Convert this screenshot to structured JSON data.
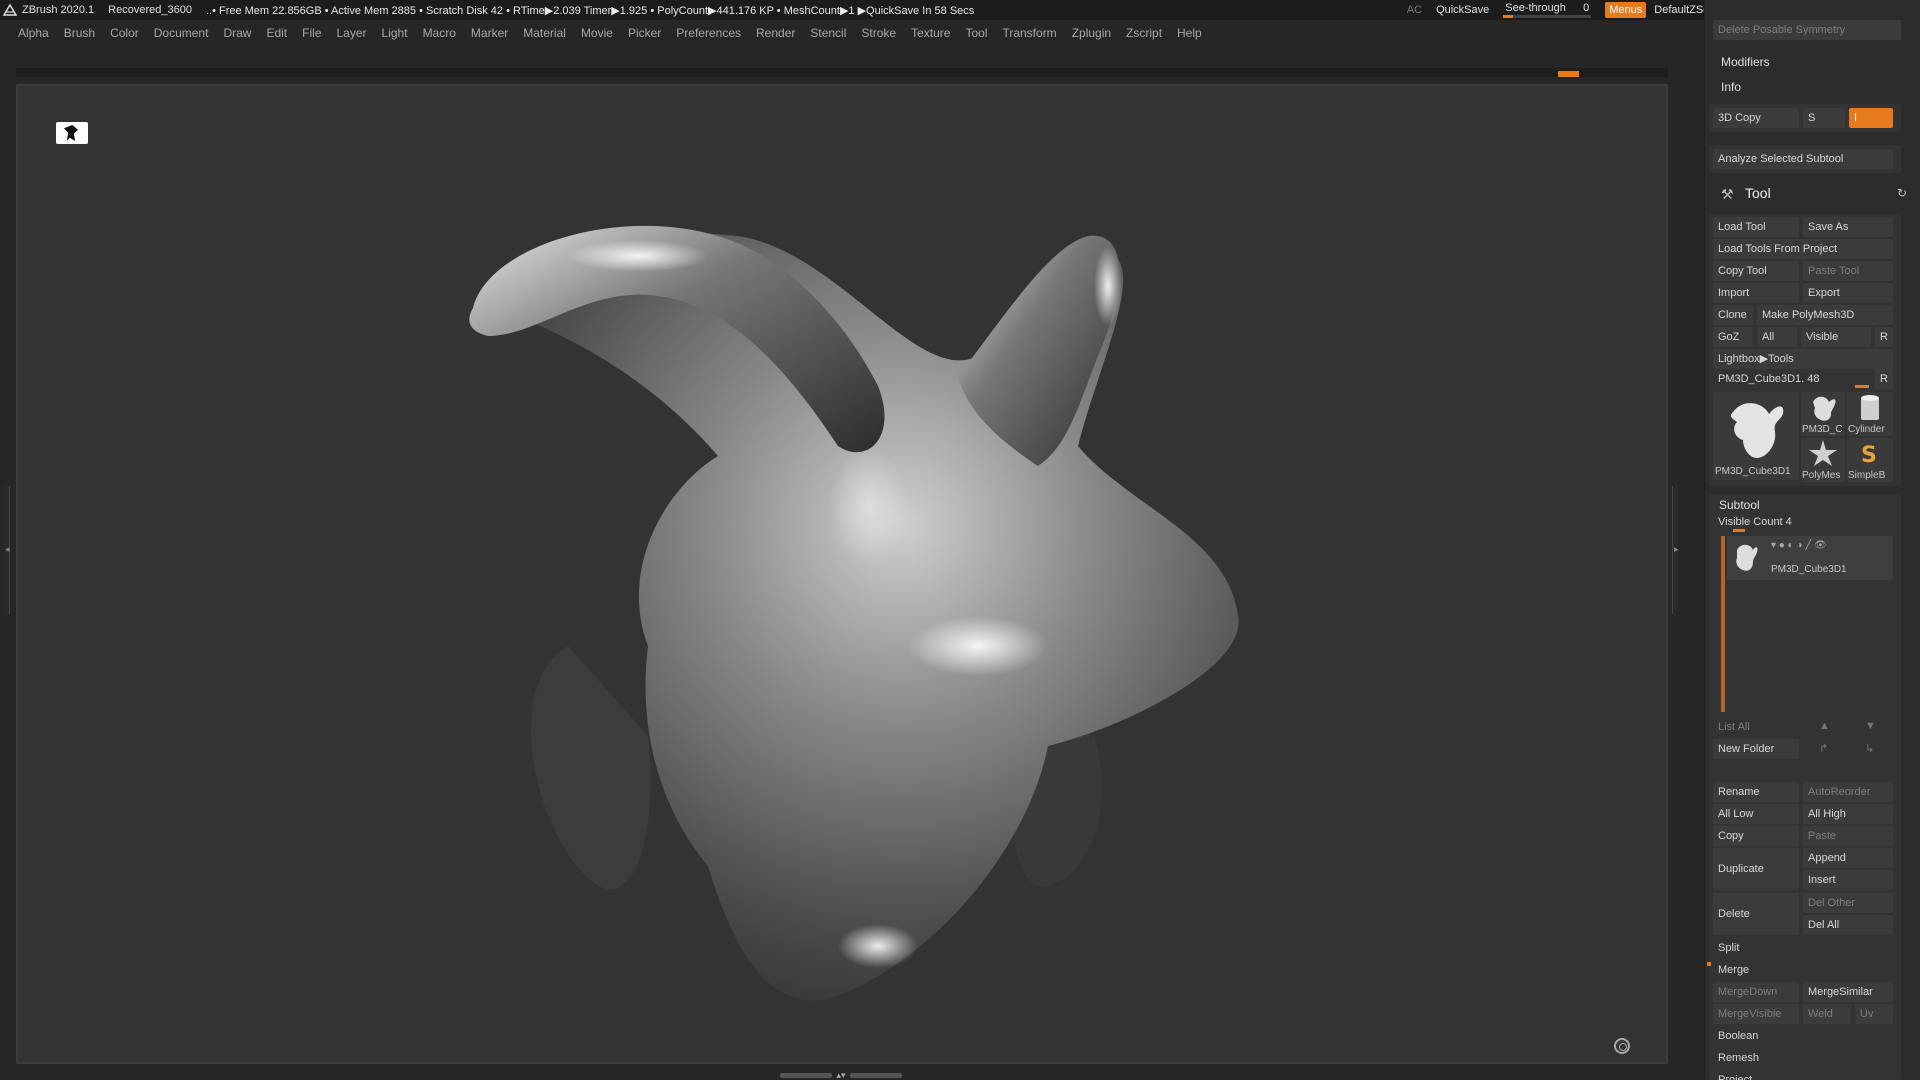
{
  "titlebar": {
    "app": "ZBrush 2020.1",
    "file": "Recovered_3600",
    "info": "..• Free Mem 22.856GB • Active Mem 2885 • Scratch Disk 42 • RTime▶2.039 Timer▶1.925 • PolyCount▶441.176 KP • MeshCount▶1 ▶QuickSave In 58 Secs",
    "ac": "AC",
    "quicksave": "QuickSave",
    "see_through_label": "See-through",
    "see_through_value": "0",
    "menus": "Menus",
    "default_zscript": "DefaultZScript"
  },
  "menubar": {
    "items": [
      "Alpha",
      "Brush",
      "Color",
      "Document",
      "Draw",
      "Edit",
      "File",
      "Layer",
      "Light",
      "Macro",
      "Marker",
      "Material",
      "Movie",
      "Picker",
      "Preferences",
      "Render",
      "Stencil",
      "Stroke",
      "Texture",
      "Tool",
      "Transform",
      "Zplugin",
      "Zscript",
      "Help"
    ]
  },
  "rpanel": {
    "delete_posable": "Delete Posable Symmetry",
    "modifiers": "Modifiers",
    "info": "Info",
    "copy3d": "3D Copy",
    "copy3d_s": "S",
    "copy3d_i": "I",
    "analyze": "Analyze Selected Subtool",
    "tool_title": "Tool",
    "load_tool": "Load Tool",
    "save_as": "Save As",
    "load_from_project": "Load Tools From Project",
    "copy_tool": "Copy Tool",
    "paste_tool": "Paste Tool",
    "import": "Import",
    "export": "Export",
    "clone": "Clone",
    "make_polymesh": "Make PolyMesh3D",
    "goz": "GoZ",
    "all": "All",
    "visible": "Visible",
    "r": "R",
    "lightbox_tools": "Lightbox▶Tools",
    "current_tool": "PM3D_Cube3D1. 48",
    "thumb_main_label": "PM3D_Cube3D1",
    "thumb_labels": [
      "PM3D_C",
      "Cylinder",
      "PolyMes",
      "SimpleB"
    ],
    "subtool_title": "Subtool",
    "visible_count": "Visible Count 4",
    "subtool_name": "PM3D_Cube3D1",
    "list_all": "List All",
    "new_folder": "New Folder",
    "rename": "Rename",
    "autoreorder": "AutoReorder",
    "all_low": "All Low",
    "all_high": "All High",
    "copy": "Copy",
    "paste": "Paste",
    "duplicate": "Duplicate",
    "append": "Append",
    "insert": "Insert",
    "delete": "Delete",
    "del_other": "Del Other",
    "del_all": "Del All",
    "split": "Split",
    "merge": "Merge",
    "merge_down": "MergeDown",
    "merge_similar": "MergeSimilar",
    "merge_visible": "MergeVisible",
    "weld": "Weld",
    "uv": "Uv",
    "boolean": "Boolean",
    "remesh": "Remesh",
    "project": "Project"
  },
  "colors": {
    "accent": "#e87a1e",
    "canvas": "#333333",
    "panel": "#2c2c2c"
  }
}
